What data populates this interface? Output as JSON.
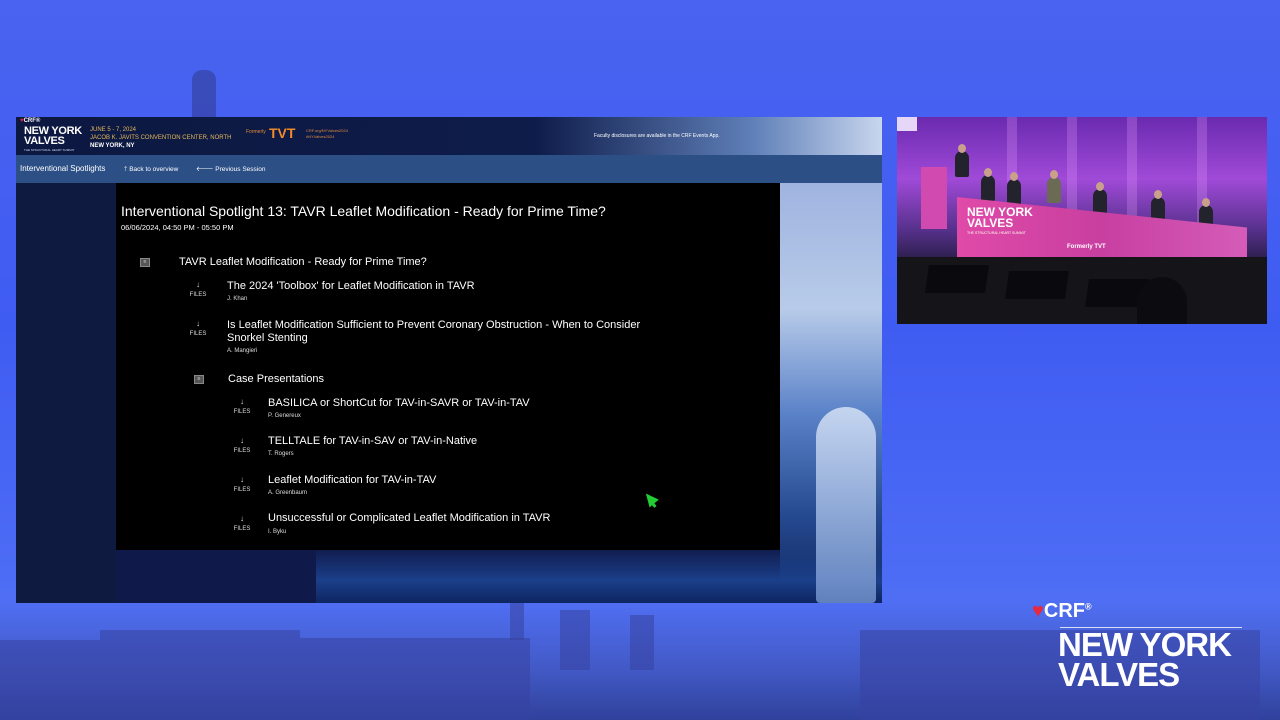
{
  "conference": {
    "crf": "CRF®",
    "logo_line1": "NEW YORK",
    "logo_line2": "VALVES",
    "logo_sub": "THE STRUCTURAL HEART SUMMIT",
    "dates": "JUNE 5 - 7, 2024",
    "venue": "JACOB K. JAVITS CONVENTION CENTER, NORTH",
    "city": "NEW YORK, NY",
    "formerly": "Formerly",
    "tvt": "TVT",
    "link1": "CRF.org/NYValves2024",
    "link2": "#NYValves2024",
    "disclosure": "Faculty disclosures are available in the CRF Events App."
  },
  "nav": {
    "title": "Interventional Spotlights",
    "back": "Back to overview",
    "back_icon": "arrow-up-icon",
    "prev": "Previous Session",
    "prev_icon": "arrow-left-icon"
  },
  "session": {
    "title": "Interventional Spotlight 13: TAVR Leaflet Modification - Ready for Prime Time?",
    "time": "06/06/2024, 04:50 PM - 05:50 PM"
  },
  "files_label": "FILES",
  "group": {
    "title": "TAVR Leaflet Modification - Ready for Prime Time?",
    "talks": [
      {
        "title": "The 2024 'Toolbox' for Leaflet Modification in TAVR",
        "speaker": "J. Khan"
      },
      {
        "title": "Is Leaflet Modification Sufficient to Prevent Coronary Obstruction - When to Consider",
        "title2": "Snorkel Stenting",
        "speaker": "A. Mangieri"
      }
    ]
  },
  "subgroup": {
    "title": "Case Presentations",
    "talks": [
      {
        "title": "BASILICA or ShortCut for TAV-in-SAVR or TAV-in-TAV",
        "speaker": "P. Genereux"
      },
      {
        "title": "TELLTALE for TAV-in-SAV or TAV-in-Native",
        "speaker": "T. Rogers"
      },
      {
        "title": "Leaflet Modification for TAV-in-TAV",
        "speaker": "A. Greenbaum"
      },
      {
        "title": "Unsuccessful or Complicated Leaflet Modification in TAVR",
        "speaker": "I. Byku"
      }
    ]
  },
  "video_stage": {
    "line1": "NEW YORK",
    "line2": "VALVES",
    "sub": "THE STRUCTURAL HEART SUMMIT",
    "tvt": "Formerly TVT"
  },
  "brand": {
    "crf": "CRF",
    "reg": "®",
    "line1": "NEW YORK",
    "line2": "VALVES"
  },
  "colors": {
    "background": "#4263f0",
    "navbar": "#2c4f86",
    "accent_red": "#e8283c",
    "stage_pink": "#d04ab0",
    "cursor": "#22cc33"
  }
}
